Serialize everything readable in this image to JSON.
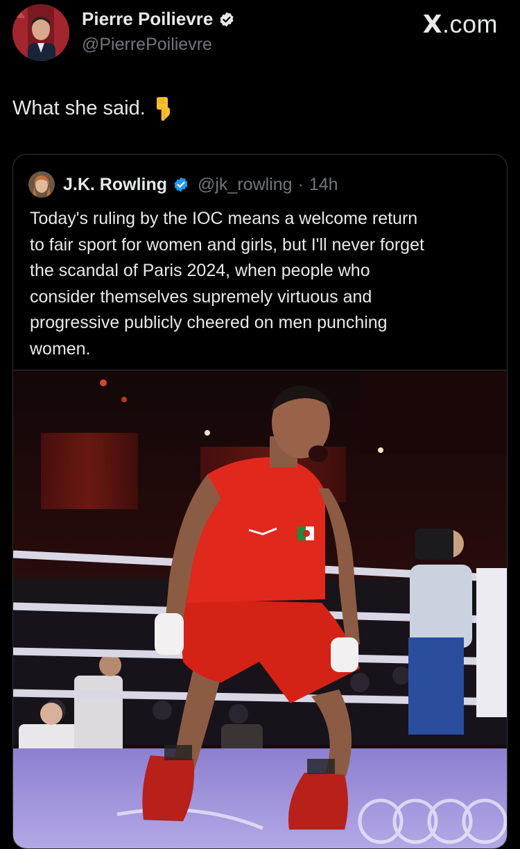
{
  "post": {
    "author_name": "Pierre Poilievre",
    "author_handle": "@PierrePoilievre",
    "brand": "X",
    "brand_suffix": ".com",
    "text": "What she said.",
    "emoji_icon": "backhand-index-pointing-down-icon"
  },
  "quoted_post": {
    "author_name": "J.K. Rowling",
    "author_handle": "@jk_rowling",
    "separator": "·",
    "time": "14h",
    "text": "Today's ruling by the IOC means a welcome return\nto fair sport for women and girls, but I'll never forget\nthe scandal of Paris 2024, when people who\nconsider themselves supremely virtuous and\nprogressive publicly cheered on men punching\nwomen."
  },
  "colors": {
    "background": "#000000",
    "text_primary": "#e7e9ea",
    "text_secondary": "#71767b",
    "verified_badge": "#1d9bf0",
    "border": "#2f3336"
  }
}
